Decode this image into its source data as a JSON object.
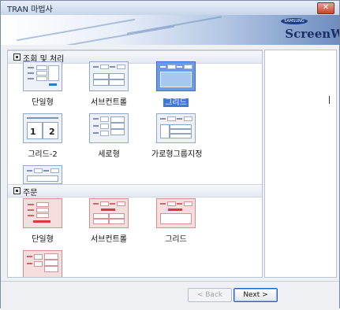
{
  "window": {
    "title": "TRAN 마법사",
    "close_symbol": "✕"
  },
  "banner": {
    "brand": "SAMSUNG",
    "product": "ScreenW"
  },
  "sections": [
    {
      "label": "조회 및 처리",
      "items": [
        {
          "label": "단일형",
          "selected": false
        },
        {
          "label": "서브컨트롤",
          "selected": false
        },
        {
          "label": "그리드",
          "selected": true
        },
        {
          "label": "그리드-2",
          "selected": false,
          "numbers": [
            "1",
            "2"
          ]
        },
        {
          "label": "세로형",
          "selected": false
        },
        {
          "label": "가로형그룹지정",
          "selected": false
        },
        {
          "label": "",
          "selected": false
        }
      ]
    },
    {
      "label": "주문",
      "items": [
        {
          "label": "단일형"
        },
        {
          "label": "서브컨트롤"
        },
        {
          "label": "그리드"
        },
        {
          "label": ""
        }
      ]
    }
  ],
  "buttons": {
    "back": "< Back",
    "next": "Next >"
  },
  "colors": {
    "selected_tile": "#6c9be3",
    "order_tile": "#f7dede",
    "accent_red": "#d83a3a"
  }
}
